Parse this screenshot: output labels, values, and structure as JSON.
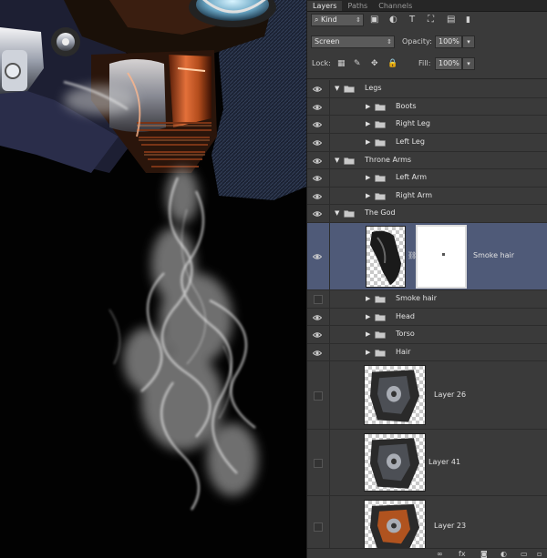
{
  "tabs": [
    {
      "label": "Layers",
      "active": true
    },
    {
      "label": "Paths",
      "active": false
    },
    {
      "label": "Channels",
      "active": false
    }
  ],
  "filter": {
    "kind_label": "Kind"
  },
  "blend": {
    "mode": "Screen",
    "opacity_label": "Opacity:",
    "opacity": "100%"
  },
  "lock": {
    "label": "Lock:",
    "fill_label": "Fill:",
    "fill": "100%"
  },
  "layers": [
    {
      "type": "group",
      "name": "Legs",
      "visible": true,
      "expanded": true,
      "indent": 0
    },
    {
      "type": "group",
      "name": "Boots",
      "visible": true,
      "expanded": false,
      "indent": 1
    },
    {
      "type": "group",
      "name": "Right Leg",
      "visible": true,
      "expanded": false,
      "indent": 1
    },
    {
      "type": "group",
      "name": "Left Leg",
      "visible": true,
      "expanded": false,
      "indent": 1
    },
    {
      "type": "group",
      "name": "Throne Arms",
      "visible": true,
      "expanded": true,
      "indent": 0
    },
    {
      "type": "group",
      "name": "Left Arm",
      "visible": true,
      "expanded": false,
      "indent": 1
    },
    {
      "type": "group",
      "name": "Right Arm",
      "visible": true,
      "expanded": false,
      "indent": 1
    },
    {
      "type": "group",
      "name": "The God",
      "visible": true,
      "expanded": true,
      "indent": 0
    },
    {
      "type": "masked",
      "name": "Smoke hair",
      "visible": true,
      "selected": true
    },
    {
      "type": "group",
      "name": "Smoke hair",
      "visible": false,
      "expanded": false,
      "indent": 1
    },
    {
      "type": "group",
      "name": "Head",
      "visible": true,
      "expanded": false,
      "indent": 1
    },
    {
      "type": "group",
      "name": "Torso",
      "visible": true,
      "expanded": false,
      "indent": 1
    },
    {
      "type": "group",
      "name": "Hair",
      "visible": true,
      "expanded": false,
      "indent": 1
    },
    {
      "type": "pixel",
      "name": "Layer 26",
      "visible": false
    },
    {
      "type": "pixel",
      "name": "Layer 41",
      "visible": false
    },
    {
      "type": "pixel",
      "name": "Layer 23",
      "visible": false
    }
  ],
  "colors": {
    "panel": "#3a3a3a",
    "selected": "#4f5a78",
    "canvas": "#020202",
    "smoke": "#bfbfbf"
  },
  "footer_icons": [
    "link-icon",
    "fx-icon",
    "mask-icon",
    "adjustment-icon",
    "folder-icon",
    "new-layer-icon",
    "trash-icon"
  ]
}
